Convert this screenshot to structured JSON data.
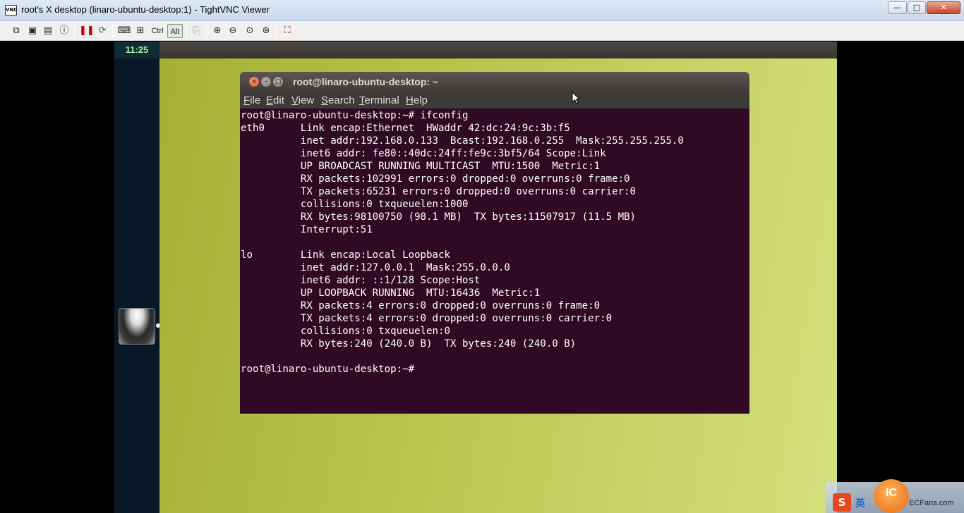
{
  "window": {
    "title": "root's X desktop (linaro-ubuntu-desktop:1) - TightVNC Viewer",
    "icon_label": "VNC",
    "minimize": "—",
    "maximize": "□",
    "close": "✕"
  },
  "toolbar": {
    "ctrl_label": "Ctrl",
    "alt_label": "Alt"
  },
  "ubuntu": {
    "clock": "11:25"
  },
  "terminal": {
    "title": "root@linaro-ubuntu-desktop: ~",
    "close": "×",
    "minimize": "–",
    "maximize": "□",
    "menu": [
      {
        "key": "F",
        "rest": "ile"
      },
      {
        "key": "E",
        "rest": "dit"
      },
      {
        "key": "V",
        "rest": "iew"
      },
      {
        "key": "S",
        "rest": "earch"
      },
      {
        "key": "T",
        "rest": "erminal"
      },
      {
        "key": "H",
        "rest": "elp"
      }
    ],
    "lines": [
      "root@linaro-ubuntu-desktop:~# ifconfig",
      "eth0      Link encap:Ethernet  HWaddr 42:dc:24:9c:3b:f5",
      "          inet addr:192.168.0.133  Bcast:192.168.0.255  Mask:255.255.255.0",
      "          inet6 addr: fe80::40dc:24ff:fe9c:3bf5/64 Scope:Link",
      "          UP BROADCAST RUNNING MULTICAST  MTU:1500  Metric:1",
      "          RX packets:102991 errors:0 dropped:0 overruns:0 frame:0",
      "          TX packets:65231 errors:0 dropped:0 overruns:0 carrier:0",
      "          collisions:0 txqueuelen:1000",
      "          RX bytes:98100750 (98.1 MB)  TX bytes:11507917 (11.5 MB)",
      "          Interrupt:51",
      "",
      "lo        Link encap:Local Loopback",
      "          inet addr:127.0.0.1  Mask:255.0.0.0",
      "          inet6 addr: ::1/128 Scope:Host",
      "          UP LOOPBACK RUNNING  MTU:16436  Metric:1",
      "          RX packets:4 errors:0 dropped:0 overruns:0 frame:0",
      "          TX packets:4 errors:0 dropped:0 overruns:0 carrier:0",
      "          collisions:0 txqueuelen:0",
      "          RX bytes:240 (240.0 B)  TX bytes:240 (240.0 B)",
      "",
      "root@linaro-ubuntu-desktop:~# "
    ]
  },
  "tray": {
    "ime": "S",
    "lang": "英",
    "logo": "IC",
    "site": "ECFans.com"
  }
}
